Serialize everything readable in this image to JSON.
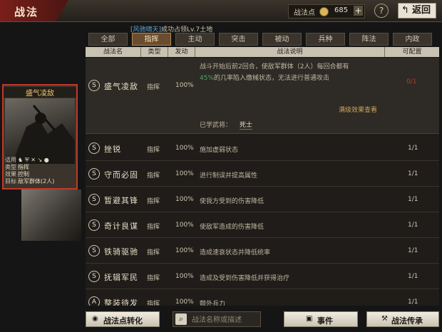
{
  "header": {
    "title": "战法",
    "points_label": "战法点",
    "points_value": "685",
    "plus": "+",
    "help": "?",
    "back_arrow": "↰",
    "back_label": "返回"
  },
  "subtitle": {
    "highlight": "[风驰啸天]",
    "text": "成功占领Lv.7土地"
  },
  "tabs": [
    "全部",
    "指挥",
    "主动",
    "突击",
    "被动",
    "兵种",
    "阵法",
    "内政"
  ],
  "active_tab": 1,
  "columns": [
    "战法名",
    "类型",
    "发动",
    "战法说明",
    "可配置"
  ],
  "expanded": {
    "icon": "S",
    "name": "盛气凌敌",
    "type": "指挥",
    "rate": "100%",
    "desc_line1": "战斗开始后前2回合，使敌军群体（2人）每回合都有",
    "desc_pct": "45%",
    "desc_line2": "的几率陷入缴械状态，无法进行普通攻击",
    "count": "0/1",
    "full_effect": "满级效果查看",
    "learned_label": "已学武将：",
    "learned_value": "死士"
  },
  "rows": [
    {
      "icon": "S",
      "name": "挫锐",
      "type": "指挥",
      "rate": "100%",
      "desc": "施加虚弱状态",
      "count": "1/1"
    },
    {
      "icon": "S",
      "name": "守而必固",
      "type": "指挥",
      "rate": "100%",
      "desc": "进行制误并提高属性",
      "count": "1/1"
    },
    {
      "icon": "S",
      "name": "暂避其锋",
      "type": "指挥",
      "rate": "100%",
      "desc": "使我方受到的伤害降低",
      "count": "1/1"
    },
    {
      "icon": "S",
      "name": "奇计良谋",
      "type": "指挥",
      "rate": "100%",
      "desc": "使敌军造成的伤害降低",
      "count": "1/1"
    },
    {
      "icon": "S",
      "name": "铁骑驱驰",
      "type": "指挥",
      "rate": "100%",
      "desc": "造成速衰状态并降低统率",
      "count": "1/1"
    },
    {
      "icon": "S",
      "name": "抚辑军民",
      "type": "指挥",
      "rate": "100%",
      "desc": "造成及受到伤害降低并获得治疗",
      "count": "1/1"
    },
    {
      "icon": "A",
      "name": "整装待发",
      "type": "指挥",
      "rate": "100%",
      "desc": "额外兵力",
      "count": "1/1"
    }
  ],
  "card": {
    "name": "盛气凌敌",
    "apply_label": "适用",
    "type_label": "类型",
    "type_value": "指挥",
    "effect_label": "效果",
    "effect_value": "控制",
    "target_label": "目标",
    "target_value": "敌军群体(2人)"
  },
  "bottom": {
    "convert_label": "战法点转化",
    "search_placeholder": "战法名称或描述",
    "event_label": "事件",
    "inherit_label": "战法传承"
  }
}
